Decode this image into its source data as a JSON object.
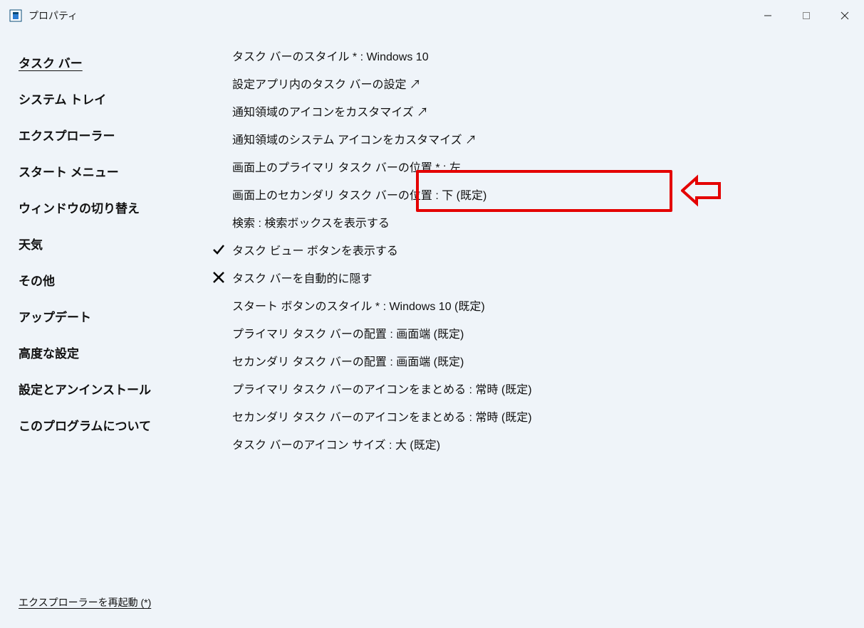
{
  "title": "プロパティ",
  "sidebar": {
    "items": [
      {
        "label": "タスク バー",
        "active": true
      },
      {
        "label": "システム トレイ",
        "active": false
      },
      {
        "label": "エクスプローラー",
        "active": false
      },
      {
        "label": "スタート メニュー",
        "active": false
      },
      {
        "label": "ウィンドウの切り替え",
        "active": false
      },
      {
        "label": "天気",
        "active": false
      },
      {
        "label": "その他",
        "active": false
      },
      {
        "label": "アップデート",
        "active": false
      },
      {
        "label": "高度な設定",
        "active": false
      },
      {
        "label": "設定とアンインストール",
        "active": false
      },
      {
        "label": "このプログラムについて",
        "active": false
      }
    ],
    "restart_link": "エクスプローラーを再起動 (*)"
  },
  "content": {
    "items": [
      {
        "label": "タスク バーのスタイル * : Windows 10",
        "icon": "none",
        "link": false
      },
      {
        "label": "設定アプリ内のタスク バーの設定 ↗",
        "icon": "none",
        "link": true
      },
      {
        "label": "通知領域のアイコンをカスタマイズ ↗",
        "icon": "none",
        "link": true
      },
      {
        "label": "通知領域のシステム アイコンをカスタマイズ ↗",
        "icon": "none",
        "link": true
      },
      {
        "label": "画面上のプライマリ タスク バーの位置 * : 左",
        "icon": "none",
        "link": false,
        "highlight": true,
        "indent": true
      },
      {
        "label": "画面上のセカンダリ タスク バーの位置 : 下 (既定)",
        "icon": "none",
        "link": false,
        "indent": true
      },
      {
        "label": "検索 : 検索ボックスを表示する",
        "icon": "none",
        "link": false,
        "indent": true
      },
      {
        "label": "タスク ビュー ボタンを表示する",
        "icon": "check",
        "link": false,
        "indent": true
      },
      {
        "label": "タスク バーを自動的に隠す",
        "icon": "cross",
        "link": false,
        "indent": true
      },
      {
        "label": "スタート ボタンのスタイル * : Windows 10 (既定)",
        "icon": "none",
        "link": false,
        "indent": true
      },
      {
        "label": "プライマリ タスク バーの配置 : 画面端 (既定)",
        "icon": "none",
        "link": false,
        "indent": true
      },
      {
        "label": "セカンダリ タスク バーの配置 : 画面端 (既定)",
        "icon": "none",
        "link": false,
        "indent": true
      },
      {
        "label": "プライマリ タスク バーのアイコンをまとめる : 常時 (既定)",
        "icon": "none",
        "link": false,
        "indent": true
      },
      {
        "label": "セカンダリ タスク バーのアイコンをまとめる : 常時 (既定)",
        "icon": "none",
        "link": false,
        "indent": true
      },
      {
        "label": "タスク バーのアイコン サイズ : 大 (既定)",
        "icon": "none",
        "link": false,
        "indent": true
      }
    ]
  },
  "colors": {
    "highlight": "#e40000",
    "bg": "#eff4f9"
  }
}
